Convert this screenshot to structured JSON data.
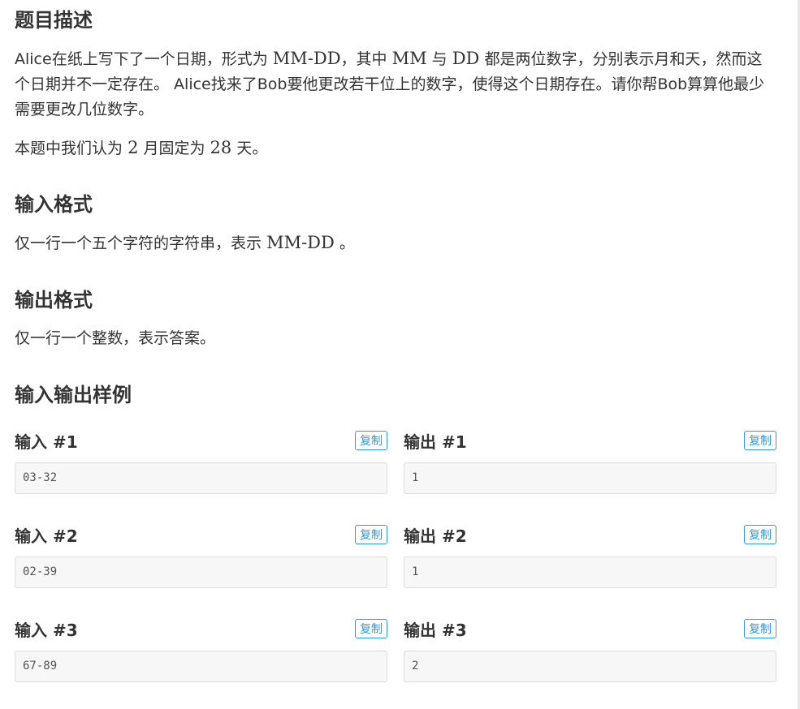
{
  "description": {
    "heading": "题目描述",
    "para1_a": "Alice在纸上写下了一个日期，形式为",
    "math_mmdd": "MM-DD",
    "para1_b": "，其中",
    "math_mm": "MM",
    "para1_c": "与",
    "math_dd": "DD",
    "para1_d": "都是两位数字，分别表示月和天，然而这个日期并不一定存在。 Alice找来了Bob要他更改若干位上的数字，使得这个日期存在。请你帮Bob算算他最少需要更改几位数字。",
    "note_a": "本题中我们认为",
    "math_2": "2",
    "note_b": "月固定为",
    "math_28": "28",
    "note_c": "天。"
  },
  "input_format": {
    "heading": "输入格式",
    "text_a": "仅一行一个五个字符的字符串，表示",
    "math": "MM-DD",
    "text_b": "。"
  },
  "output_format": {
    "heading": "输出格式",
    "text": "仅一行一个整数，表示答案。"
  },
  "samples_heading": "输入输出样例",
  "copy_label": "复制",
  "samples": [
    {
      "input_title": "输入 #1",
      "input": "03-32",
      "output_title": "输出 #1",
      "output": "1"
    },
    {
      "input_title": "输入 #2",
      "input": "02-39",
      "output_title": "输出 #2",
      "output": "1"
    },
    {
      "input_title": "输入 #3",
      "input": "67-89",
      "output_title": "输出 #3",
      "output": "2"
    }
  ]
}
